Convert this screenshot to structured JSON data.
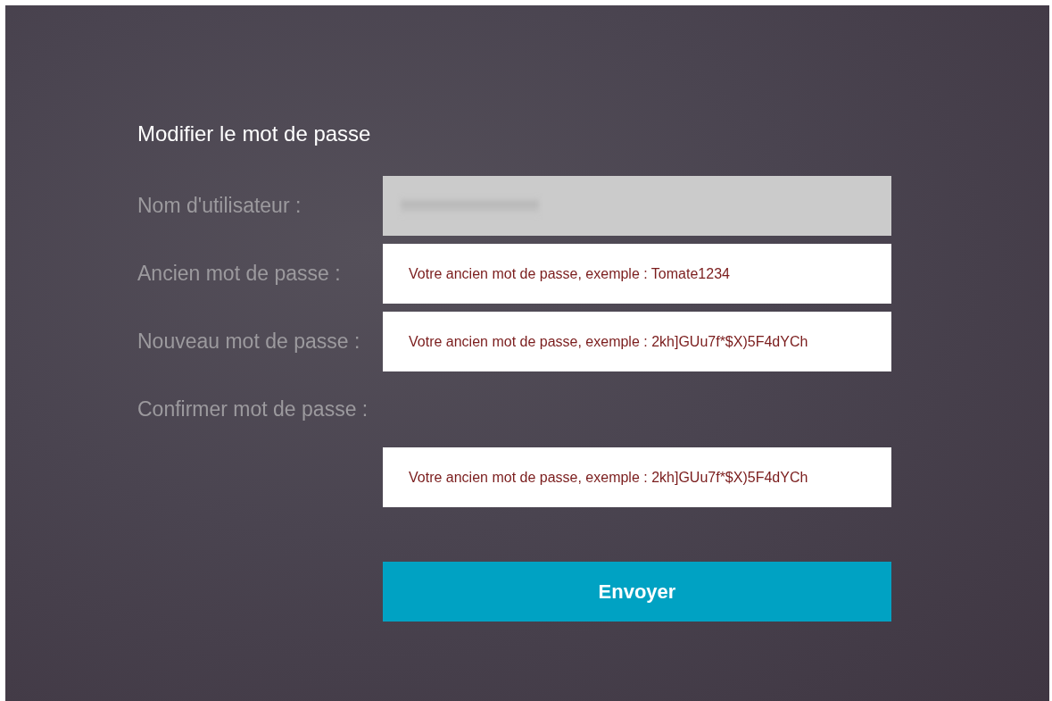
{
  "title": "Modifier le mot de passe",
  "fields": [
    {
      "label": "Nom d'utilisateur :",
      "disabled": true,
      "label_above": false
    },
    {
      "label": "Ancien mot de passe :",
      "disabled": false,
      "placeholder": "Votre ancien mot de passe, exemple : Tomate1234",
      "label_above": false
    },
    {
      "label": "Nouveau mot de passe :",
      "disabled": false,
      "placeholder": "Votre ancien mot de passe, exemple : 2kh]GUu7f*$X)5F4dYCh",
      "label_above": false
    },
    {
      "label": "Confirmer mot de passe :",
      "disabled": false,
      "placeholder": "Votre ancien mot de passe, exemple : 2kh]GUu7f*$X)5F4dYCh",
      "label_above": true
    }
  ],
  "submit": "Envoyer"
}
